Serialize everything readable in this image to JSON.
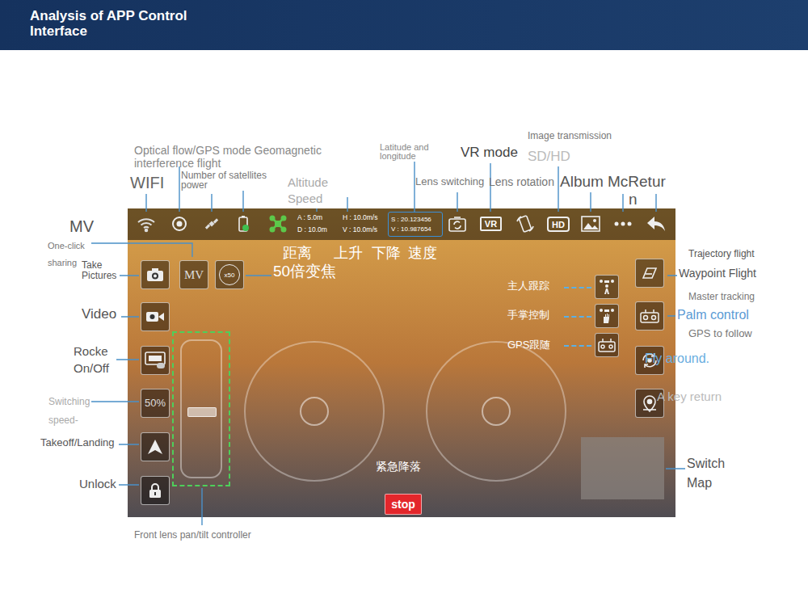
{
  "header": {
    "title_lines": [
      "Analysis of APP Control",
      "Interface"
    ]
  },
  "callouts": {
    "wifi": [
      "WIFI"
    ],
    "optical_flow": [
      "Optical flow/GPS mode Geomagnetic",
      "interference flight"
    ],
    "satellites": [
      "Number of satellites",
      "power"
    ],
    "altitude": [
      "Altitude",
      "Speed"
    ],
    "lat_lon": [
      "Latitude and",
      "longitude"
    ],
    "vr_mode": [
      "VR mode"
    ],
    "lens_switching": [
      "Lens switching"
    ],
    "lens_rotation": [
      "Lens rotation"
    ],
    "image_transmission": [
      "Image transmission"
    ],
    "sd_hd": [
      "SD/HD"
    ],
    "album": [
      "Album"
    ],
    "more_return_a": [
      "McRetur"
    ],
    "more_return_b": [
      "n"
    ],
    "mv": [
      "MV"
    ],
    "one_click": [
      "One-click",
      "sharing"
    ],
    "take_pictures": [
      "Take",
      "Pictures"
    ],
    "video": [
      "Video"
    ],
    "rocker": [
      "Rocke",
      "On/Off"
    ],
    "switching": [
      "Switching",
      "speed-"
    ],
    "takeoff": [
      "Takeoff/Landing"
    ],
    "unlock": [
      "Unlock"
    ],
    "gimbal": [
      "Front lens pan/tilt controller"
    ],
    "trajectory": [
      "Trajectory flight"
    ],
    "waypoint": [
      "Waypoint Flight"
    ],
    "master_tracking": [
      "Master tracking"
    ],
    "palm_control": [
      "Palm control"
    ],
    "gps_follow": [
      "GPS to follow"
    ],
    "fly_around": [
      "Fly around."
    ],
    "key_return": [
      "A key return"
    ],
    "switch_map": [
      "Switch",
      "Map"
    ]
  },
  "screen": {
    "status": {
      "altitude": "A : 5.0m",
      "h_speed": "H : 10.0m/s",
      "distance": "D : 10.0m",
      "v_speed": "V : 10.0m/s"
    },
    "coords": {
      "lat": "S : 20.123456",
      "lon": "V : 10.987654"
    },
    "vr_badge": "VR",
    "hd_badge": "HD",
    "mv_button": "MV",
    "zoom_badge": "x50",
    "speed_button": "50%",
    "stop_button": "stop",
    "overlay_labels": {
      "distance": "距离",
      "up": "上升",
      "down": "下降",
      "speed": "速度",
      "zoom": "50倍变焦",
      "emergency": "紧急降落"
    },
    "follow_labels": [
      "主人跟踪",
      "手掌控制",
      "GPS跟随"
    ]
  }
}
